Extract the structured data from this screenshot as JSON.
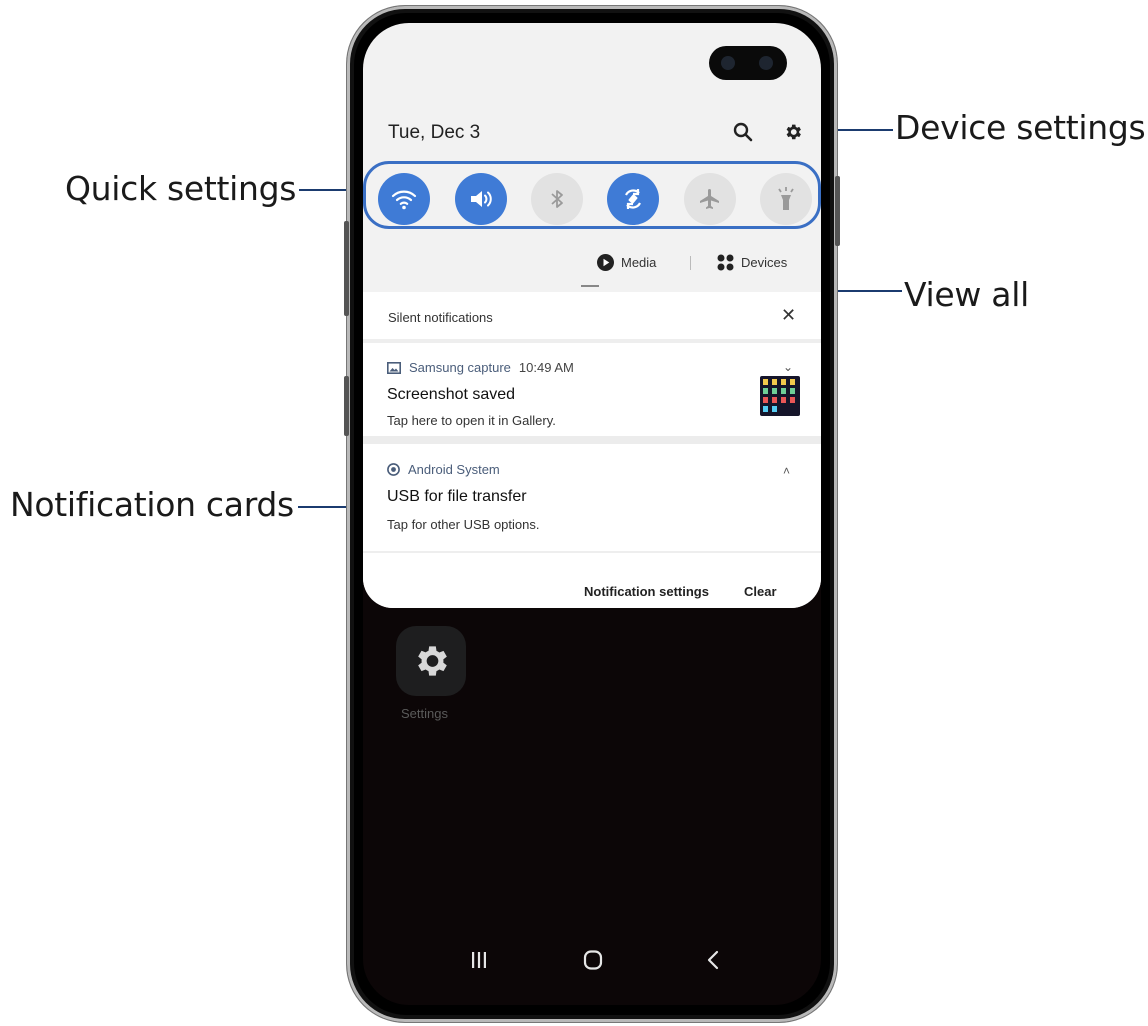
{
  "callouts": {
    "device_settings": "Device settings",
    "quick_settings": "Quick settings",
    "view_all": "View all",
    "notification_cards": "Notification cards"
  },
  "status": {
    "date": "Tue, Dec 3"
  },
  "header_icons": [
    "search-icon",
    "gear-icon"
  ],
  "quick_settings": [
    {
      "name": "wifi",
      "icon": "wifi-icon",
      "state": "on"
    },
    {
      "name": "sound",
      "icon": "volume-icon",
      "state": "on"
    },
    {
      "name": "bluetooth",
      "icon": "bluetooth-icon",
      "state": "off"
    },
    {
      "name": "auto-rotate",
      "icon": "rotate-icon",
      "state": "on"
    },
    {
      "name": "airplane",
      "icon": "airplane-icon",
      "state": "off"
    },
    {
      "name": "flashlight",
      "icon": "flashlight-icon",
      "state": "off"
    }
  ],
  "shade_buttons": {
    "media": "Media",
    "devices": "Devices"
  },
  "notifications": {
    "section_title": "Silent notifications",
    "cards": [
      {
        "app": "Samsung capture",
        "time": "10:49 AM",
        "title": "Screenshot saved",
        "body": "Tap here to open it in Gallery.",
        "app_icon": "image-icon",
        "chevron": "expand"
      },
      {
        "app": "Android System",
        "time": "",
        "title": "USB for file transfer",
        "body": "Tap for other USB options.",
        "app_icon": "android-system-icon",
        "chevron": "collapse"
      }
    ],
    "footer": {
      "settings": "Notification settings",
      "clear": "Clear"
    }
  },
  "home": {
    "app_label": "Settings"
  },
  "colors": {
    "accent": "#3f7bd6",
    "outline": "#3a6fc4",
    "leader": "#1b3b6f",
    "shade": "#f2f2f2",
    "screen_bg": "#0c0607"
  }
}
